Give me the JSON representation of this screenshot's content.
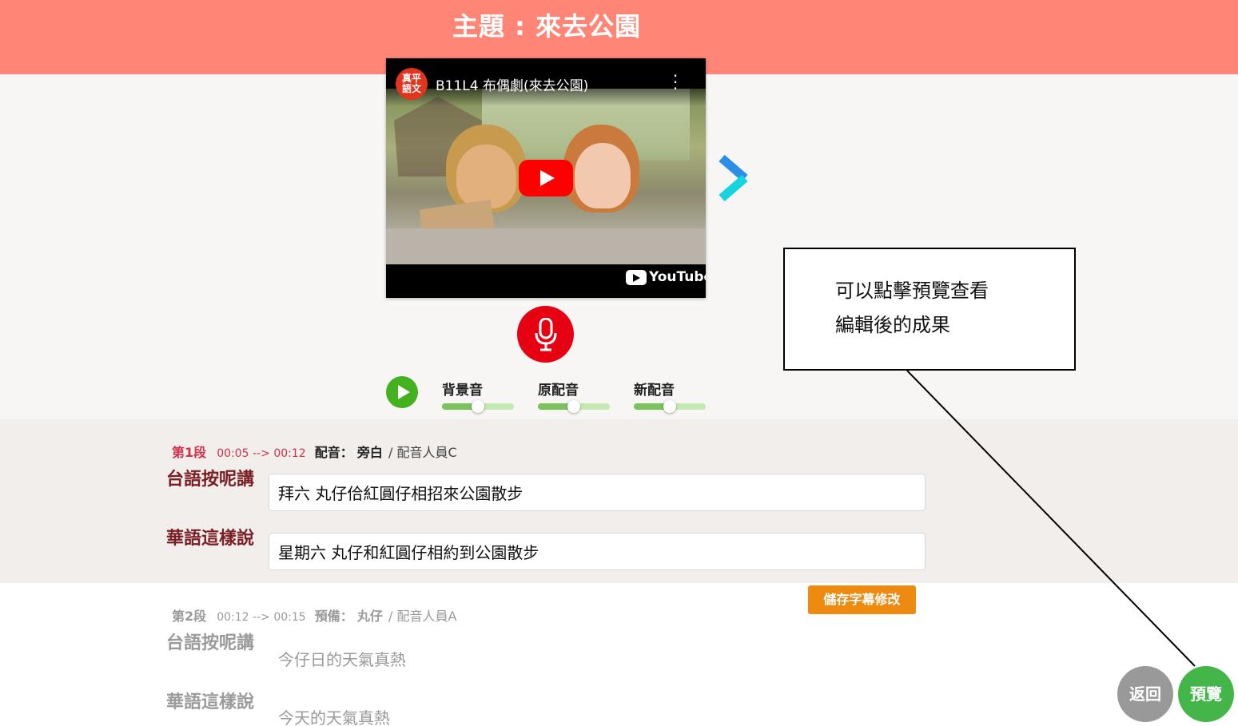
{
  "header": {
    "title": "主題 : 來去公園"
  },
  "video": {
    "channel_logo_line1": "真平",
    "channel_logo_line2": "語文",
    "title": "B11L4 布偶劇(來去公園)",
    "brand": "YouTube"
  },
  "audio": {
    "sliders": [
      {
        "label": "背景音",
        "level": 0.5
      },
      {
        "label": "原配音",
        "level": 0.5
      },
      {
        "label": "新配音",
        "level": 0.5
      }
    ]
  },
  "callout": {
    "line1": "可以點擊預覽查看",
    "line2": "編輯後的成果"
  },
  "segments": [
    {
      "number": "第1段",
      "time": "00:05 --> 00:12",
      "role_label": "配音：",
      "role": "旁白",
      "actor": "/ 配音人員C",
      "taiwanese_label": "台語按呢講",
      "taiwanese_text": "拜六 丸仔佮紅圓仔相招來公園散步",
      "mandarin_label": "華語這樣說",
      "mandarin_text": "星期六 丸仔和紅圓仔相約到公園散步"
    },
    {
      "number": "第2段",
      "time": "00:12 --> 00:15",
      "role_label": "預備：",
      "role": "丸仔",
      "actor": "/ 配音人員A",
      "taiwanese_label": "台語按呢講",
      "taiwanese_text": "今仔日的天氣真熱",
      "mandarin_label": "華語這樣說",
      "mandarin_text": "今天的天氣真熱"
    }
  ],
  "buttons": {
    "save_subtitles": "儲存字幕修改",
    "back": "返回",
    "preview": "預覽"
  },
  "colors": {
    "header": "#ff8676",
    "record": "#e60012",
    "play": "#44b21f",
    "save": "#ef8a10",
    "preview": "#43b549",
    "back": "#999999",
    "active_segment_number": "#d0324c",
    "active_label": "#7a1e23"
  }
}
